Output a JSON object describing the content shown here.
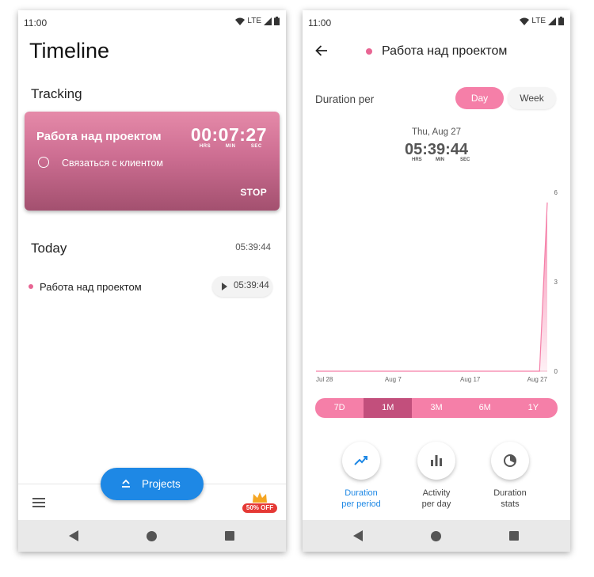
{
  "status": {
    "time": "11:00",
    "network": "LTE"
  },
  "screen1": {
    "title": "Timeline",
    "tracking": {
      "heading": "Tracking",
      "project": "Работа над проектом",
      "timer": "00:07:27",
      "units": [
        "HRS",
        "MIN",
        "SEC"
      ],
      "task": "Связаться с клиентом",
      "stop_label": "STOP"
    },
    "today": {
      "heading": "Today",
      "total": "05:39:44",
      "entries": [
        {
          "name": "Работа над проектом",
          "time": "05:39:44",
          "dot_color": "#e86593"
        }
      ]
    },
    "fab_label": "Projects",
    "promo": "50% OFF",
    "menu_icon": "hamburger-icon"
  },
  "screen2": {
    "title": "Работа над проектом",
    "duration_per": "Duration per",
    "toggle": {
      "day": "Day",
      "week": "Week",
      "selected": "Day"
    },
    "date": "Thu, Aug 27",
    "total": "05:39:44",
    "units": [
      "HRS",
      "MIN",
      "SEC"
    ],
    "ranges": [
      "7D",
      "1M",
      "3M",
      "6M",
      "1Y"
    ],
    "selected_range": "1M",
    "buttons": [
      {
        "line1": "Duration",
        "line2": "per period",
        "icon": "trend-up-icon",
        "active": true
      },
      {
        "line1": "Activity",
        "line2": "per day",
        "icon": "bar-chart-icon",
        "active": false
      },
      {
        "line1": "Duration",
        "line2": "stats",
        "icon": "pie-chart-icon",
        "active": false
      }
    ]
  },
  "accent_pink": "#f57fa8",
  "accent_blue": "#1e88e5",
  "chart_data": {
    "type": "area",
    "x_ticks": [
      "Jul 28",
      "Aug 7",
      "Aug 17",
      "Aug 27"
    ],
    "y_ticks": [
      "0",
      "3",
      "6"
    ],
    "ylim": [
      0,
      6
    ],
    "x": [
      "Jul 28",
      "Jul 29",
      "Jul 30",
      "Jul 31",
      "Aug 1",
      "Aug 2",
      "Aug 3",
      "Aug 4",
      "Aug 5",
      "Aug 6",
      "Aug 7",
      "Aug 8",
      "Aug 9",
      "Aug 10",
      "Aug 11",
      "Aug 12",
      "Aug 13",
      "Aug 14",
      "Aug 15",
      "Aug 16",
      "Aug 17",
      "Aug 18",
      "Aug 19",
      "Aug 20",
      "Aug 21",
      "Aug 22",
      "Aug 23",
      "Aug 24",
      "Aug 25",
      "Aug 26",
      "Aug 27"
    ],
    "values": [
      0,
      0,
      0,
      0,
      0,
      0,
      0,
      0,
      0,
      0,
      0,
      0,
      0,
      0,
      0,
      0,
      0,
      0,
      0,
      0,
      0,
      0,
      0,
      0,
      0,
      0,
      0,
      0,
      0,
      0,
      5.66
    ],
    "y_axis_position": "right",
    "grid": false
  }
}
